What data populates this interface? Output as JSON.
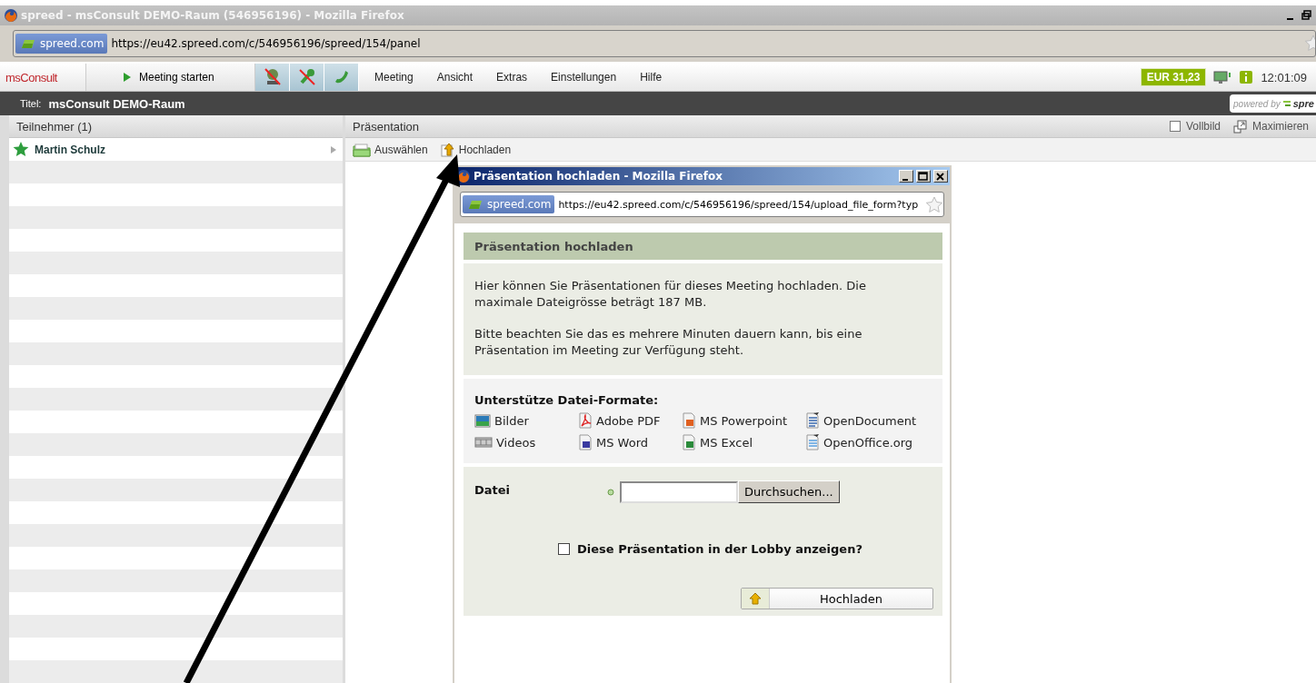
{
  "window": {
    "title": "spreed - msConsult DEMO-Raum (546956196) - Mozilla Firefox",
    "site_badge": "spreed.com",
    "url": "https://eu42.spreed.com/c/546956196/spreed/154/panel"
  },
  "toolbar": {
    "logo": "msConsult",
    "start_button": "Meeting starten",
    "menu": [
      "Meeting",
      "Ansicht",
      "Extras",
      "Einstellungen",
      "Hilfe"
    ],
    "balance": "EUR 31,23",
    "clock": "12:01:09"
  },
  "room_bar": {
    "label": "Titel:",
    "title": "msConsult DEMO-Raum",
    "powered_by": "powered by",
    "brand": "spre"
  },
  "participants": {
    "header": "Teilnehmer (1)",
    "items": [
      {
        "name": "Martin Schulz"
      }
    ]
  },
  "presentation": {
    "header": "Präsentation",
    "fullscreen": {
      "label": "Vollbild",
      "checked": false
    },
    "maximize": "Maximieren",
    "actions": [
      {
        "label": "Auswählen",
        "kind": "folder"
      },
      {
        "label": "Hochladen",
        "kind": "upload"
      }
    ]
  },
  "dialog": {
    "title": "Präsentation hochladen - Mozilla Firefox",
    "site_badge": "spreed.com",
    "url": "https://eu42.spreed.com/c/546956196/spreed/154/upload_file_form?typ",
    "heading": "Präsentation hochladen",
    "paragraphs": [
      "Hier können Sie Präsentationen für dieses Meeting hochladen. Die maximale Dateigrösse beträgt 187 MB.",
      "Bitte beachten Sie das es mehrere Minuten dauern kann, bis eine Präsentation im Meeting zur Verfügung steht."
    ],
    "formats_heading": "Unterstütze Datei-Formate:",
    "formats": [
      {
        "label": "Bilder",
        "kind": "image"
      },
      {
        "label": "Adobe PDF",
        "kind": "pdf"
      },
      {
        "label": "MS Powerpoint",
        "kind": "powerpoint"
      },
      {
        "label": "OpenDocument",
        "kind": "opendocument"
      },
      {
        "label": "Videos",
        "kind": "video"
      },
      {
        "label": "MS Word",
        "kind": "word"
      },
      {
        "label": "MS Excel",
        "kind": "excel"
      },
      {
        "label": "OpenOffice.org",
        "kind": "openoffice"
      }
    ],
    "file_label": "Datei",
    "browse_button": "Durchsuchen...",
    "lobby": {
      "label": "Diese Präsentation in der Lobby anzeigen?",
      "checked": false
    },
    "submit_button": "Hochladen"
  }
}
